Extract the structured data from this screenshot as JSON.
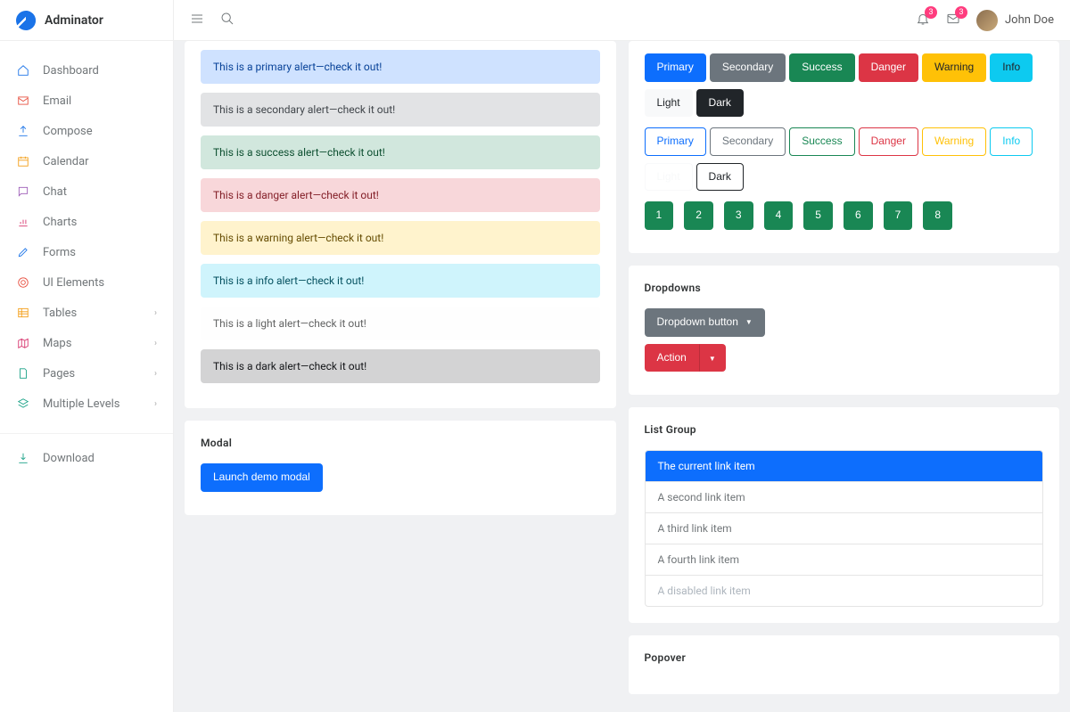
{
  "brand": "Adminator",
  "user": {
    "name": "John Doe"
  },
  "notifications": {
    "bell": 3,
    "mail": 3
  },
  "sidebar": {
    "items": [
      {
        "label": "Dashboard",
        "icon": "home",
        "expandable": false
      },
      {
        "label": "Email",
        "icon": "mail",
        "expandable": false
      },
      {
        "label": "Compose",
        "icon": "share",
        "expandable": false
      },
      {
        "label": "Calendar",
        "icon": "calendar",
        "expandable": false
      },
      {
        "label": "Chat",
        "icon": "chat",
        "expandable": false
      },
      {
        "label": "Charts",
        "icon": "chart",
        "expandable": false
      },
      {
        "label": "Forms",
        "icon": "pencil",
        "expandable": false
      },
      {
        "label": "UI Elements",
        "icon": "target",
        "expandable": false
      },
      {
        "label": "Tables",
        "icon": "table",
        "expandable": true
      },
      {
        "label": "Maps",
        "icon": "map",
        "expandable": true
      },
      {
        "label": "Pages",
        "icon": "file",
        "expandable": true
      },
      {
        "label": "Multiple Levels",
        "icon": "layers",
        "expandable": true
      }
    ],
    "download": "Download"
  },
  "alerts": [
    {
      "text": "This is a primary alert—check it out!",
      "variant": "primary"
    },
    {
      "text": "This is a secondary alert—check it out!",
      "variant": "secondary"
    },
    {
      "text": "This is a success alert—check it out!",
      "variant": "success"
    },
    {
      "text": "This is a danger alert—check it out!",
      "variant": "danger"
    },
    {
      "text": "This is a warning alert—check it out!",
      "variant": "warning"
    },
    {
      "text": "This is a info alert—check it out!",
      "variant": "info"
    },
    {
      "text": "This is a light alert—check it out!",
      "variant": "light"
    },
    {
      "text": "This is a dark alert—check it out!",
      "variant": "dark"
    }
  ],
  "modal": {
    "title": "Modal",
    "button": "Launch demo modal"
  },
  "buttons": {
    "variants": [
      "Primary",
      "Secondary",
      "Success",
      "Danger",
      "Warning",
      "Info",
      "Light",
      "Dark"
    ],
    "numbers": [
      "1",
      "2",
      "3",
      "4",
      "5",
      "6",
      "7",
      "8"
    ]
  },
  "dropdowns": {
    "title": "Dropdowns",
    "btn1": "Dropdown button",
    "btn2": "Action"
  },
  "listGroup": {
    "title": "List Group",
    "items": [
      {
        "label": "The current link item",
        "state": "active"
      },
      {
        "label": "A second link item",
        "state": ""
      },
      {
        "label": "A third link item",
        "state": ""
      },
      {
        "label": "A fourth link item",
        "state": ""
      },
      {
        "label": "A disabled link item",
        "state": "disabled"
      }
    ]
  },
  "popover": {
    "title": "Popover"
  }
}
